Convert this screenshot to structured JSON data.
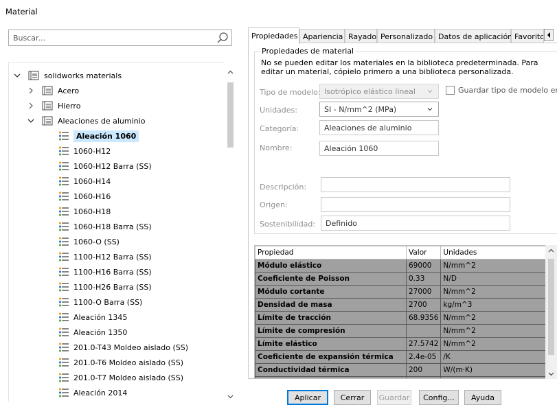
{
  "window": {
    "title": "Material"
  },
  "search": {
    "placeholder": "Buscar..."
  },
  "tree": {
    "root": "solidworks materials",
    "folders": [
      "Acero",
      "Hierro",
      "Aleaciones de aluminio"
    ],
    "selected": "Aleación 1060",
    "items": [
      "Aleación 1060",
      "1060-H12",
      "1060-H12 Barra (SS)",
      "1060-H14",
      "1060-H16",
      "1060-H18",
      "1060-H18 Barra (SS)",
      "1060-O (SS)",
      "1100-H12 Barra (SS)",
      "1100-H16 Barra (SS)",
      "1100-H26 Barra (SS)",
      "1100-O Barra (SS)",
      "Aleación 1345",
      "Aleación 1350",
      "201.0-T43 Moldeo aislado (SS)",
      "201.0-T6 Moldeo aislado (SS)",
      "201.0-T7 Moldeo aislado (SS)",
      "Aleación 2014"
    ]
  },
  "tabs": [
    "Propiedades",
    "Apariencia",
    "Rayado",
    "Personalizado",
    "Datos de aplicación",
    "Favorito"
  ],
  "group": {
    "title": "Propiedades de material",
    "info": "No se pueden editar los materiales en la biblioteca predeterminada. Para editar un material, cópielo primero a una biblioteca personalizada."
  },
  "fields": {
    "model_type_label": "Tipo de modelo:",
    "model_type_value": "Isotrópico elástico lineal",
    "save_model_type_label": "Guardar tipo de modelo en la",
    "units_label": "Unidades:",
    "units_value": "SI - N/mm^2 (MPa)",
    "category_label": "Categoría:",
    "category_value": "Aleaciones de aluminio",
    "name_label": "Nombre:",
    "name_value": "Aleación 1060",
    "description_label": "Descripción:",
    "description_value": "",
    "origin_label": "Origen:",
    "origin_value": "",
    "sustainability_label": "Sostenibilidad:",
    "sustainability_value": "Definido"
  },
  "table": {
    "headers": [
      "Propiedad",
      "Valor",
      "Unidades"
    ],
    "rows": [
      [
        "Módulo elástico",
        "69000",
        "N/mm^2"
      ],
      [
        "Coeficiente de Poisson",
        "0.33",
        "N/D"
      ],
      [
        "Módulo cortante",
        "27000",
        "N/mm^2"
      ],
      [
        "Densidad de masa",
        "2700",
        "kg/m^3"
      ],
      [
        "Límite de tracción",
        "68.9356",
        "N/mm^2"
      ],
      [
        "Límite de compresión",
        "",
        "N/mm^2"
      ],
      [
        "Límite elástico",
        "27.5742",
        "N/mm^2"
      ],
      [
        "Coeficiente de expansión térmica",
        "2.4e-05",
        "/K"
      ],
      [
        "Conductividad térmica",
        "200",
        "W/(m·K)"
      ],
      [
        "",
        "",
        ""
      ]
    ]
  },
  "buttons": {
    "apply": "Aplicar",
    "close": "Cerrar",
    "save": "Guardar",
    "config": "Config...",
    "help": "Ayuda"
  },
  "colors": {
    "selection": "#cce8ff",
    "table_row": "#a0a0a0",
    "primary_border": "#0078d7"
  }
}
